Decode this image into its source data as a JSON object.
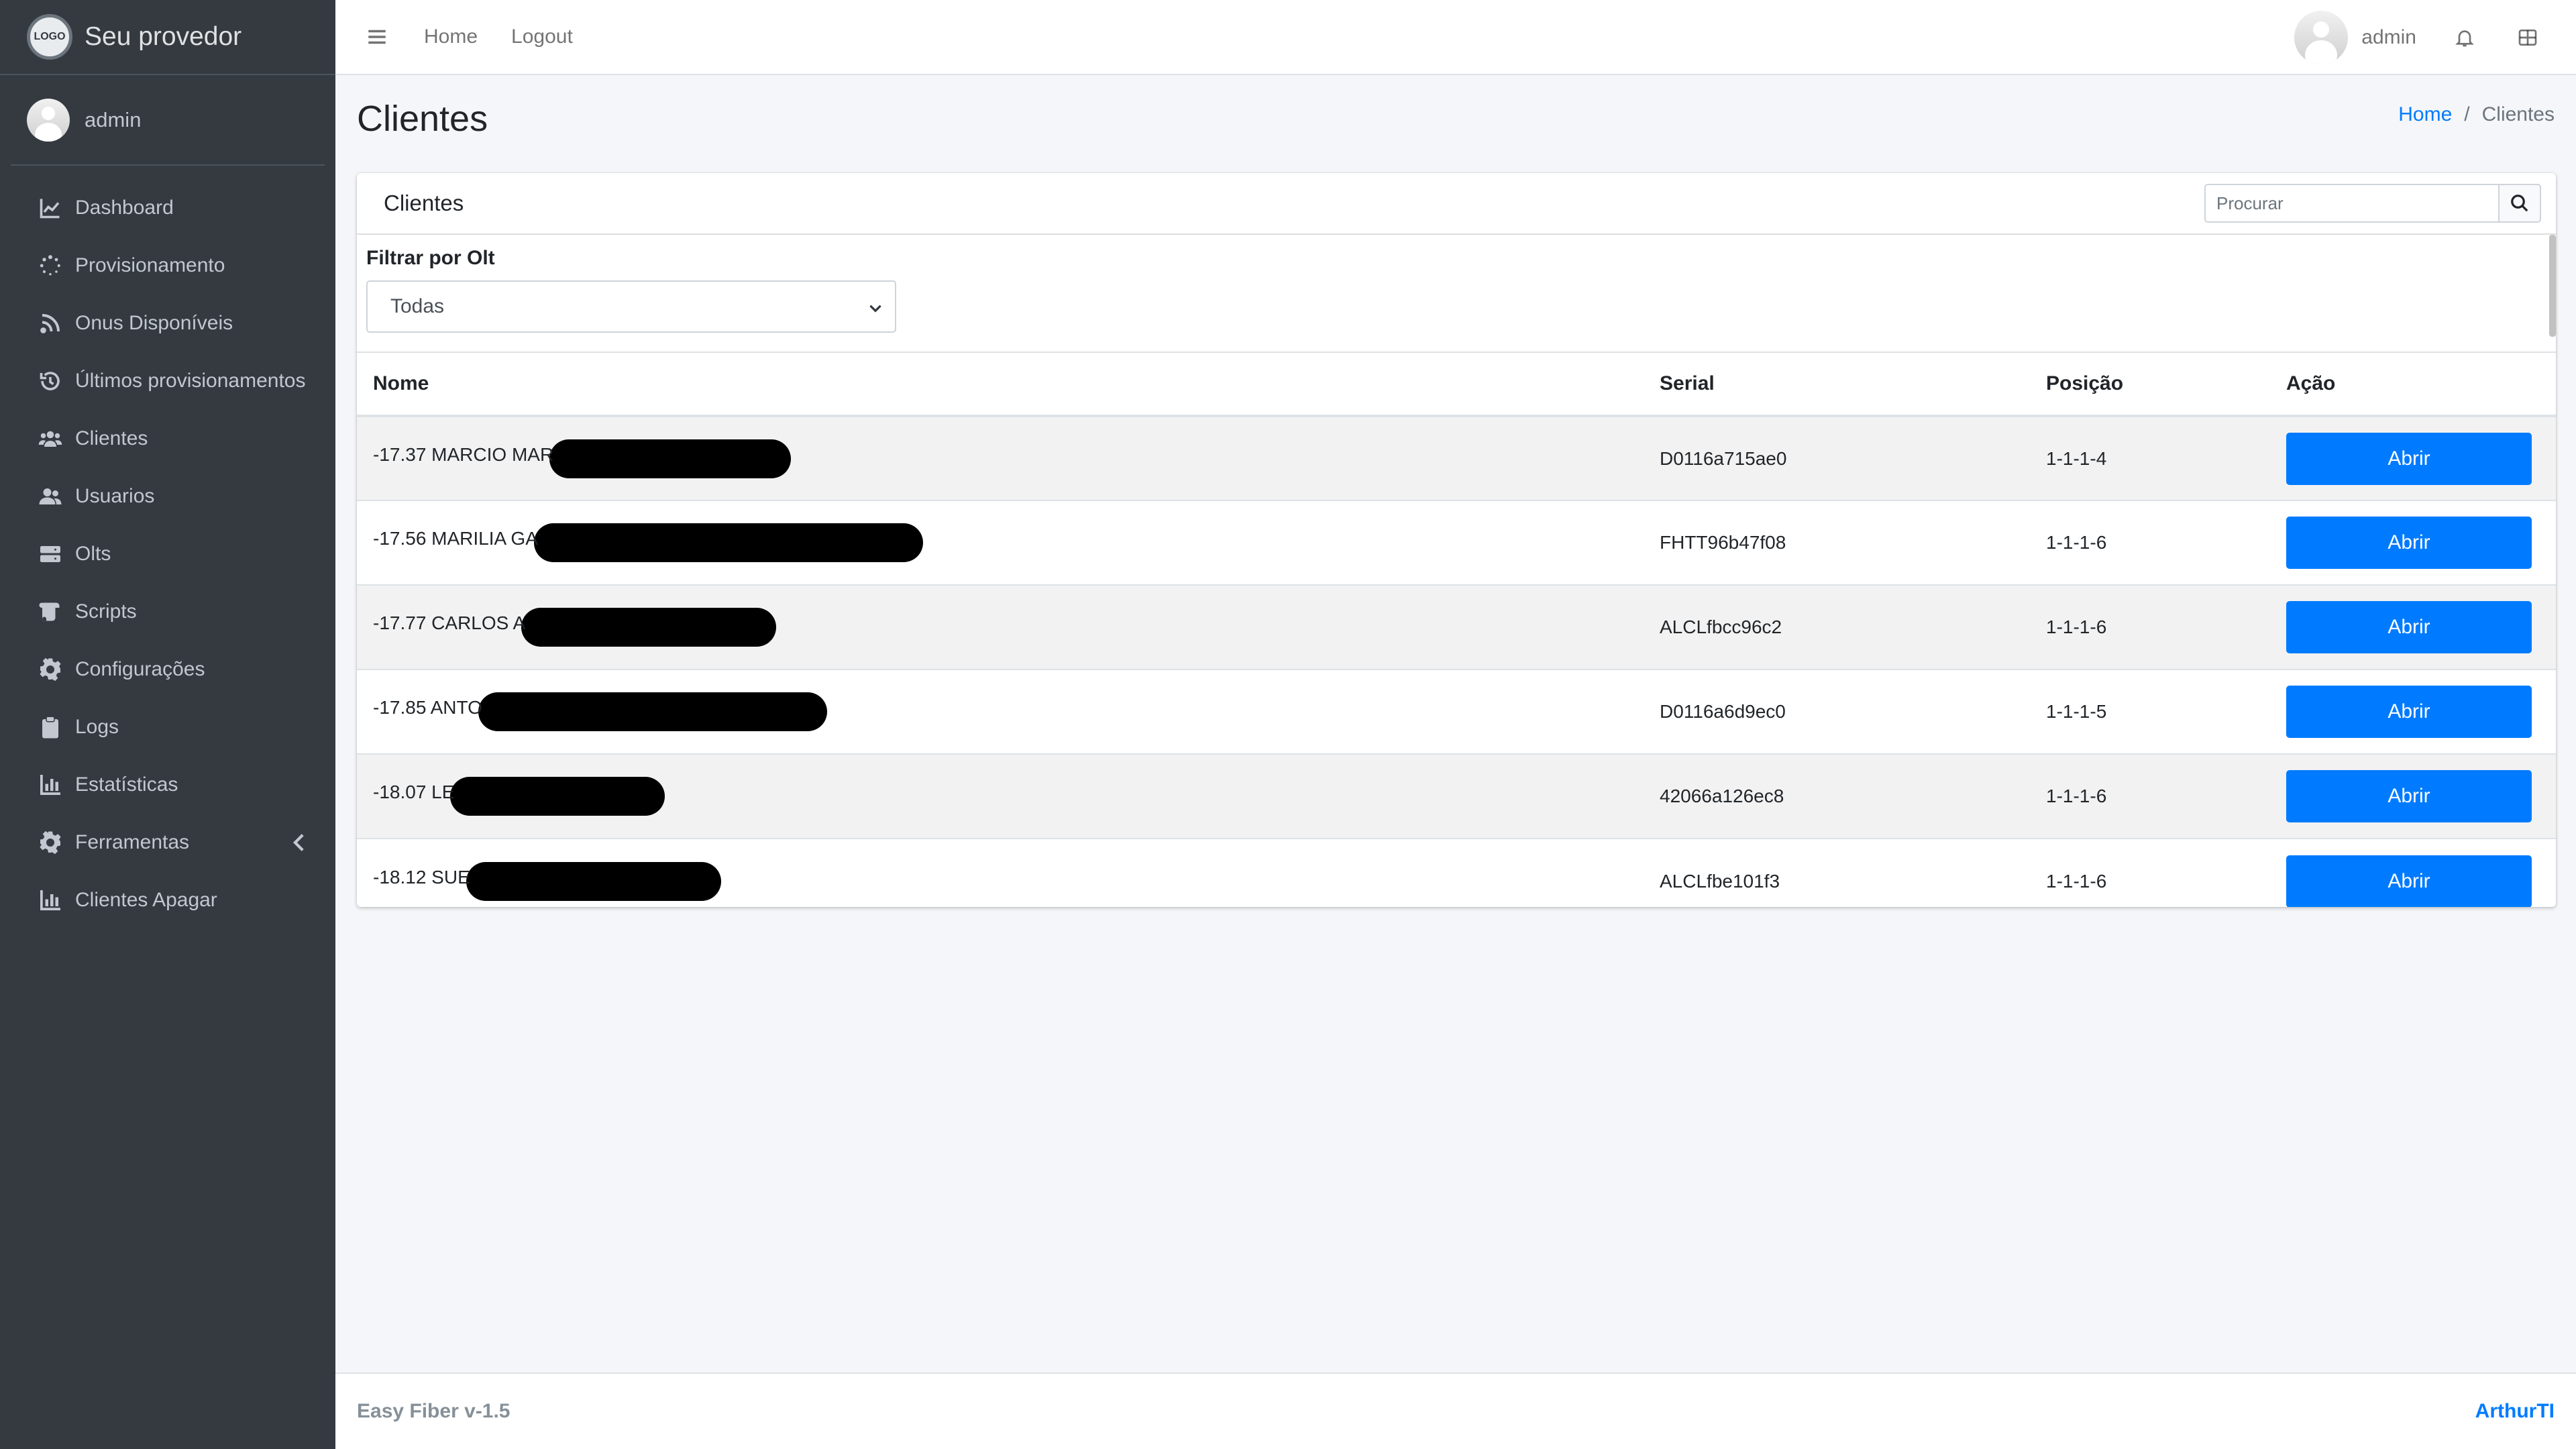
{
  "brand": {
    "name": "Seu provedor",
    "logo_text": "LOGO"
  },
  "sidebar": {
    "user": "admin",
    "items": [
      {
        "label": "Dashboard",
        "icon": "chart-line-icon"
      },
      {
        "label": "Provisionamento",
        "icon": "spinner-icon"
      },
      {
        "label": "Onus Disponíveis",
        "icon": "rss-icon"
      },
      {
        "label": "Últimos provisionamentos",
        "icon": "history-icon"
      },
      {
        "label": "Clientes",
        "icon": "users-icon"
      },
      {
        "label": "Usuarios",
        "icon": "user-friends-icon"
      },
      {
        "label": "Olts",
        "icon": "server-icon"
      },
      {
        "label": "Scripts",
        "icon": "scroll-icon"
      },
      {
        "label": "Configurações",
        "icon": "cog-icon"
      },
      {
        "label": "Logs",
        "icon": "clipboard-icon"
      },
      {
        "label": "Estatísticas",
        "icon": "chart-bar-icon"
      },
      {
        "label": "Ferramentas",
        "icon": "cog-icon",
        "has_submenu": true
      },
      {
        "label": "Clientes Apagar",
        "icon": "chart-bar-icon"
      }
    ]
  },
  "topbar": {
    "home": "Home",
    "logout": "Logout",
    "user": "admin"
  },
  "header": {
    "title": "Clientes"
  },
  "breadcrumb": {
    "home": "Home",
    "separator": "/",
    "current": "Clientes"
  },
  "card": {
    "title": "Clientes",
    "search_placeholder": "Procurar",
    "filter_label": "Filtrar por Olt",
    "filter_value": "Todas"
  },
  "table": {
    "columns": {
      "nome": "Nome",
      "serial": "Serial",
      "posicao": "Posição",
      "acao": "Ação"
    },
    "rows": [
      {
        "nome": "-17.37 MARCIO MAR",
        "serial": "D0116a715ae0",
        "posicao": "1-1-1-4",
        "acao": "Abrir"
      },
      {
        "nome": "-17.56 MARILIA GA",
        "serial": "FHTT96b47f08",
        "posicao": "1-1-1-6",
        "acao": "Abrir"
      },
      {
        "nome": "-17.77 CARLOS A",
        "serial": "ALCLfbcc96c2",
        "posicao": "1-1-1-6",
        "acao": "Abrir"
      },
      {
        "nome": "-17.85 ANTO",
        "serial": "D0116a6d9ec0",
        "posicao": "1-1-1-5",
        "acao": "Abrir"
      },
      {
        "nome": "-18.07 LE",
        "serial": "42066a126ec8",
        "posicao": "1-1-1-6",
        "acao": "Abrir"
      },
      {
        "nome": "-18.12 SUE",
        "serial": "ALCLfbe101f3",
        "posicao": "1-1-1-6",
        "acao": "Abrir"
      }
    ]
  },
  "footer": {
    "version": "Easy Fiber v-1.5",
    "author": "ArthurTI"
  },
  "colors": {
    "sidebar_bg": "#343a40",
    "accent": "#007bff",
    "page_bg": "#f4f6f9"
  }
}
